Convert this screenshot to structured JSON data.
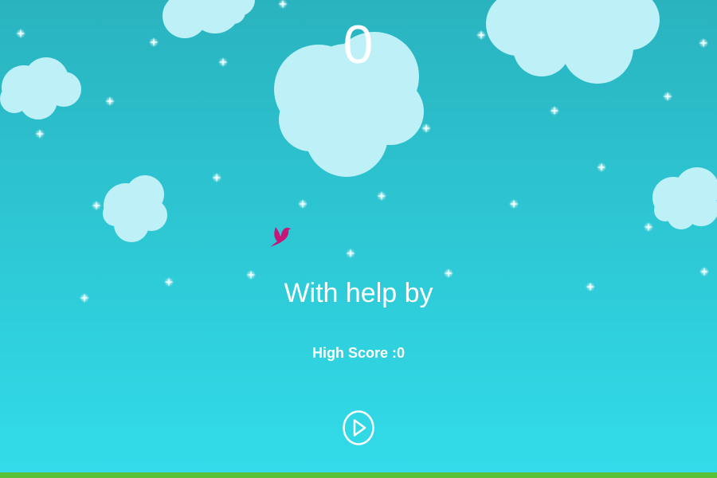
{
  "colors": {
    "sky_top": "#29B3BF",
    "sky_bottom": "#32DCEA",
    "cloud": "#BDF1F7",
    "star": "#E9FFFF",
    "text": "#FFFFFF",
    "bird": "#C8157A",
    "ground": "#58C13A"
  },
  "hud": {
    "score": "0"
  },
  "menu": {
    "caption": "With help by",
    "high_score": "High Score :0"
  },
  "icons": {
    "bird": "bird-icon",
    "play": "play-icon",
    "cloud": "cloud-icon",
    "star": "star-icon"
  }
}
